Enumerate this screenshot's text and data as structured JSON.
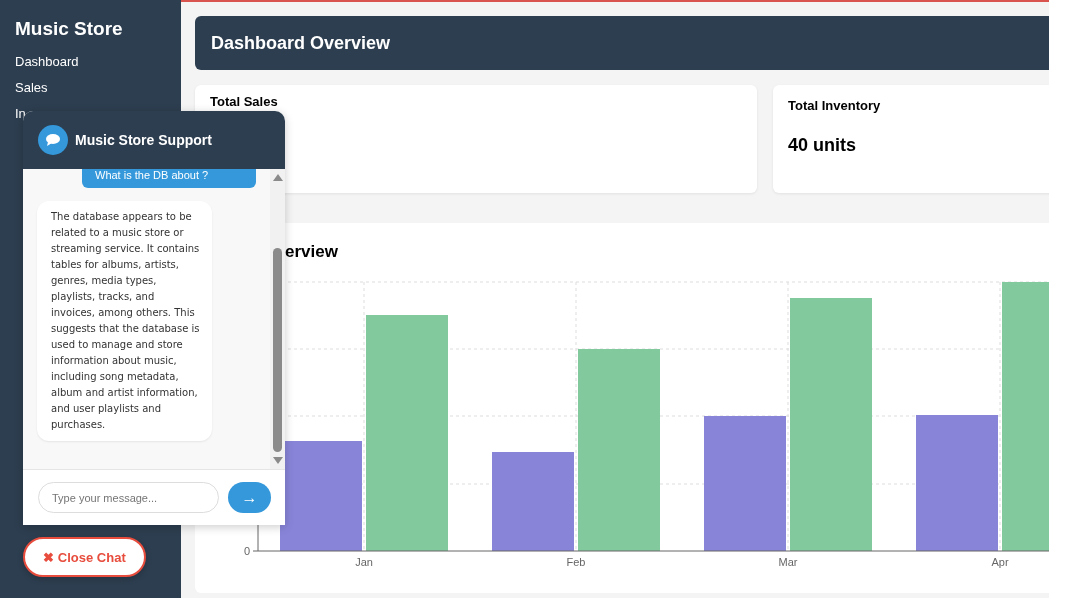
{
  "sidebar": {
    "title": "Music Store",
    "items": [
      "Dashboard",
      "Sales",
      "In"
    ]
  },
  "header": {
    "title": "Dashboard Overview"
  },
  "cards": [
    {
      "title": "Total Sales"
    },
    {
      "title": "Total Inventory",
      "value": "40 units"
    }
  ],
  "chart_panel": {
    "title": "erview",
    "y_tick": "0",
    "categories": [
      "Jan",
      "Feb",
      "Mar",
      "Apr"
    ]
  },
  "chat": {
    "title": "Music Store Support",
    "messages": [
      {
        "kind": "user",
        "text": "What is the DB about ?"
      },
      {
        "kind": "bot",
        "text": "The database appears to be related to a music store or streaming service. It contains tables for albums, artists, genres, media types, playlists, tracks, and invoices, among others. This suggests that the database is used to manage and store information about music, including song metadata, album and artist information, and user playlists and purchases."
      }
    ],
    "placeholder": "Type your message...",
    "send": "→"
  },
  "close_button": "✖ Close Chat"
}
